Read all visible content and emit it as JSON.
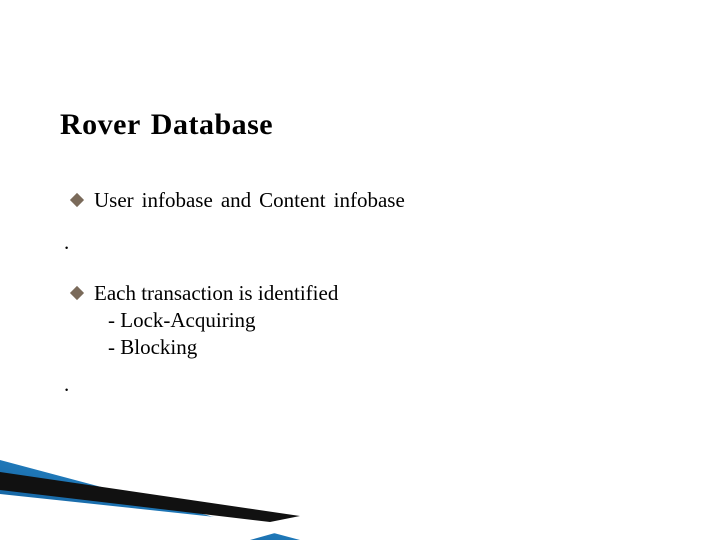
{
  "title": {
    "word1": "Rover",
    "word2": "Database"
  },
  "bullets": [
    {
      "parts": [
        "User",
        "infobase",
        "and",
        "Content",
        "infobase"
      ]
    },
    {
      "line1": "Each transaction is identified",
      "sub1": "- Lock-Acquiring",
      "sub2": "- Blocking"
    }
  ],
  "dots": [
    ".",
    "."
  ]
}
